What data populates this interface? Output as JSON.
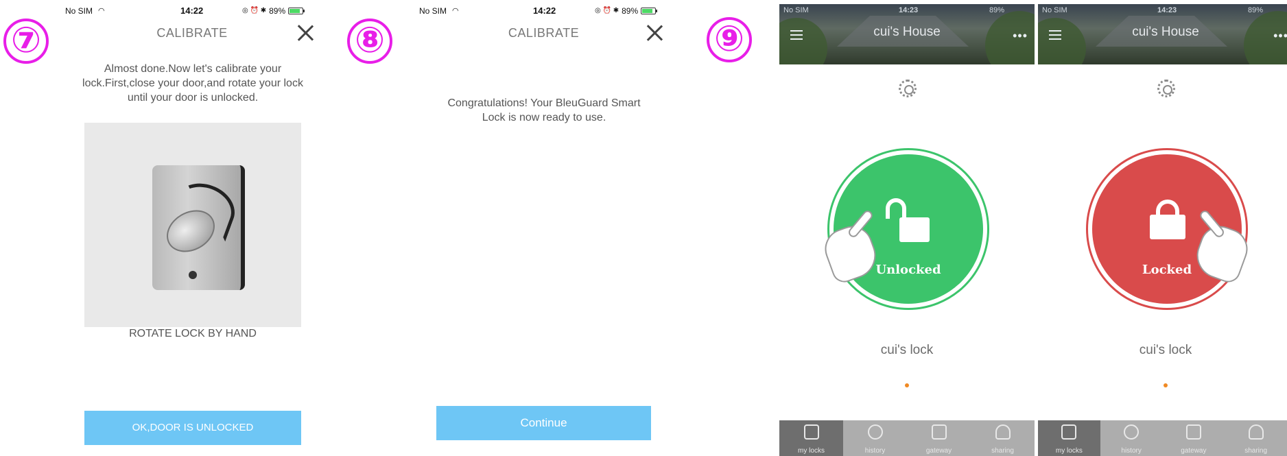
{
  "steps": [
    "⑦",
    "⑧",
    "⑨"
  ],
  "status": {
    "carrier": "No SIM",
    "time_a": "14:22",
    "time_b": "14:23",
    "battery": "89%",
    "right_icons": "◎ ⏰ ✱"
  },
  "screen7": {
    "title": "CALIBRATE",
    "instruction": "Almost done.Now let's calibrate your lock.First,close your door,and rotate your lock until your door is unlocked.",
    "image_caption": "ROTATE LOCK BY HAND",
    "button_label": "OK,DOOR IS UNLOCKED"
  },
  "screen8": {
    "title": "CALIBRATE",
    "message": "Congratulations! Your BleuGuard Smart Lock is now ready to use.",
    "button_label": "Continue"
  },
  "screen9a": {
    "house_title": "cui's House",
    "state_label": "Unlocked",
    "lock_name": "cui's lock",
    "state_color": "#3cc46b"
  },
  "screen9b": {
    "house_title": "cui's House",
    "state_label": "Locked",
    "lock_name": "cui's lock",
    "state_color": "#d94b4b"
  },
  "tabs": [
    "my locks",
    "history",
    "gateway",
    "sharing"
  ],
  "icons": {
    "close": "close-icon",
    "menu": "hamburger-menu-icon",
    "more": "more-dots-icon",
    "settings": "gear-icon",
    "lock": "padlock-icon",
    "hand": "pointing-hand-icon"
  }
}
